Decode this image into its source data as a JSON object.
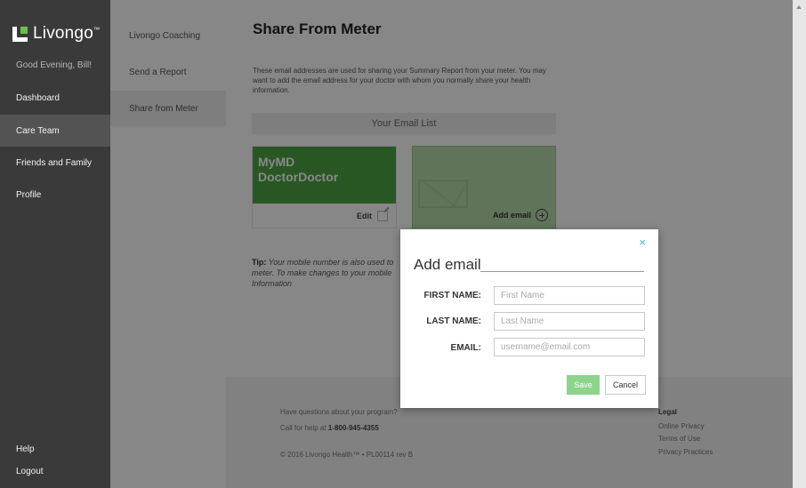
{
  "brand": {
    "name": "Livongo",
    "tm": "™",
    "accent": "#4ea444"
  },
  "sidebar": {
    "greeting": "Good Evening, Bill!",
    "items": [
      {
        "label": "Dashboard"
      },
      {
        "label": "Care Team"
      },
      {
        "label": "Friends and Family"
      },
      {
        "label": "Profile"
      }
    ],
    "help": "Help",
    "logout": "Logout"
  },
  "subnav": {
    "items": [
      {
        "label": "Livongo Coaching"
      },
      {
        "label": "Send a Report"
      },
      {
        "label": "Share from Meter"
      }
    ]
  },
  "main": {
    "title": "Share From Meter",
    "intro": "These email addresses are used for sharing your Summary Report from your meter. You may want to add the email address for your doctor with whom you normally share your health information.",
    "email_list_header": "Your Email List",
    "doctor_card": {
      "name_line1": "MyMD",
      "name_line2": "DoctorDoctor",
      "edit_label": "Edit"
    },
    "add_card": {
      "label": "Add email"
    },
    "tip": {
      "label": "Tip:",
      "text": "Your mobile number is also used to",
      "text2": "meter. To make changes to your mobile",
      "text3": "Information"
    },
    "footer": {
      "questions": "Have questions about your program?",
      "call_prefix": "Call for help at",
      "phone": "1-800-945-4355",
      "copyright": "© 2016 Livongo Health™ • PL00114 rev B",
      "legal_heading": "Legal",
      "legal_links": [
        "Online Privacy",
        "Terms of Use",
        "Privacy Practices"
      ]
    }
  },
  "modal": {
    "title": "Add email",
    "close": "×",
    "fields": [
      {
        "label": "FIRST NAME:",
        "placeholder": "First Name",
        "value": ""
      },
      {
        "label": "LAST NAME:",
        "placeholder": "Last Name",
        "value": ""
      },
      {
        "label": "EMAIL:",
        "placeholder": "username@email.com",
        "value": ""
      }
    ],
    "save_label": "Save",
    "cancel_label": "Cancel"
  }
}
